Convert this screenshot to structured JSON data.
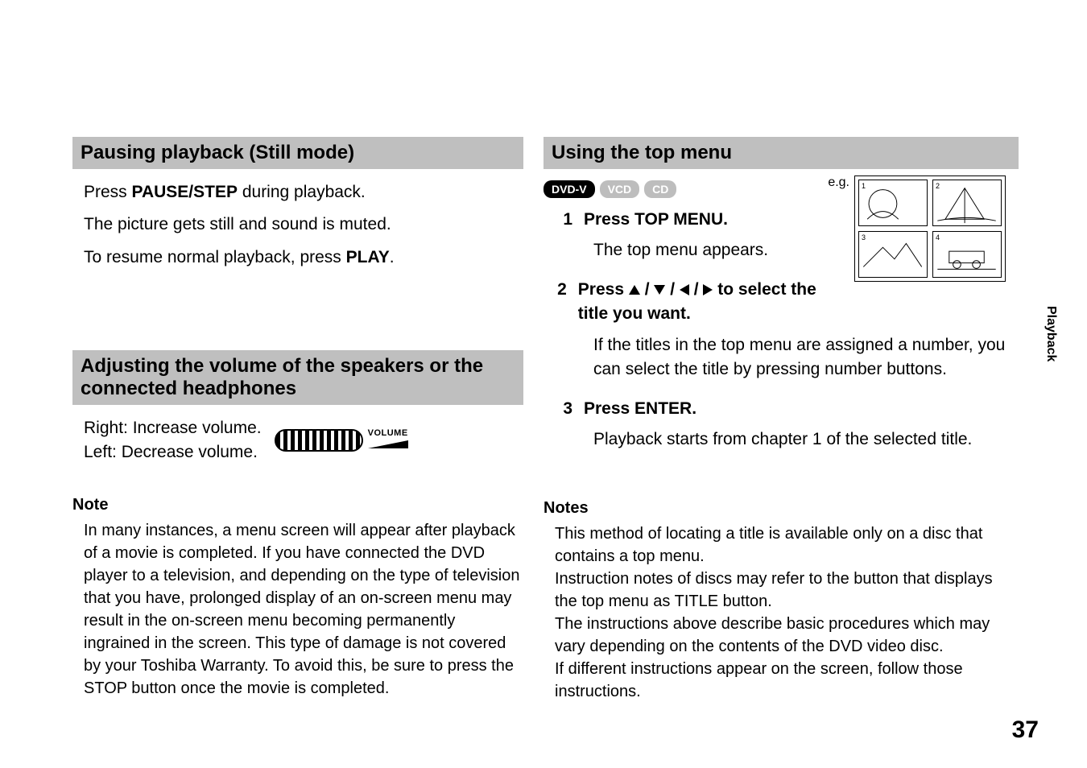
{
  "side_tab": "Playback",
  "page_number": "37",
  "left": {
    "section1_title": "Pausing playback (Still mode)",
    "section1_line1_a": "Press ",
    "section1_line1_b": "PAUSE/STEP",
    "section1_line1_c": " during playback.",
    "section1_line2": "The picture gets still and sound is muted.",
    "section1_line3_a": "To resume normal playback, press ",
    "section1_line3_b": "PLAY",
    "section1_line3_c": ".",
    "section2_title": "Adjusting the volume of the speakers or the connected headphones",
    "vol_right": "Right: Increase volume.",
    "vol_left": "Left: Decrease volume.",
    "vol_label": "VOLUME",
    "note_head": "Note",
    "note_body": "In many instances, a menu screen will appear after playback of a movie is completed. If you have connected the DVD player to a television, and depending on the type of television that you have, prolonged display of an on-screen menu may result in the on-screen menu becoming permanently ingrained in the screen. This type of damage is not covered by your Toshiba Warranty. To avoid this, be sure to press the STOP button once the movie is completed."
  },
  "right": {
    "section_title": "Using the top menu",
    "badges": {
      "dvdv": "DVD-V",
      "vcd": "VCD",
      "cd": "CD"
    },
    "eg_label": "e.g.",
    "steps": {
      "s1_num": "1",
      "s1_title": "Press TOP MENU.",
      "s1_body": "The top menu appears.",
      "s2_num": "2",
      "s2_title_a": "Press ",
      "s2_title_b": " to select the title you want.",
      "s2_body": "If the titles in the top menu are assigned a number, you can select the title by pressing number buttons.",
      "s3_num": "3",
      "s3_title": "Press ENTER.",
      "s3_body": "Playback starts from chapter 1 of the selected title."
    },
    "notes_head": "Notes",
    "notes": [
      "This method of locating a title is available only on a disc that contains a top menu.",
      "Instruction notes of discs may refer to the button that displays the top menu as TITLE button.",
      "The instructions above describe basic procedures which may vary depending on the contents of the DVD video disc.",
      "If different instructions appear on the screen, follow those instructions."
    ],
    "thumb_nums": [
      "1",
      "2",
      "3",
      "4"
    ]
  }
}
